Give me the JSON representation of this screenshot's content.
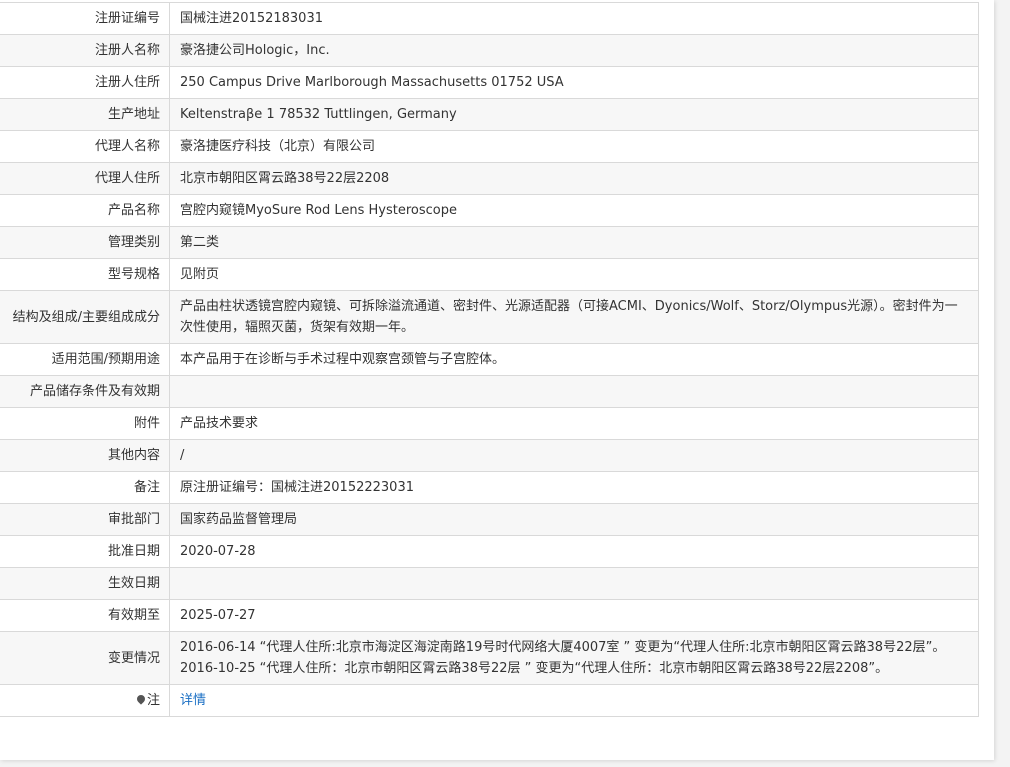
{
  "rows": [
    {
      "label": "注册证编号",
      "value": "国械注进20152183031"
    },
    {
      "label": "注册人名称",
      "value": "豪洛捷公司Hologic，Inc."
    },
    {
      "label": "注册人住所",
      "value": "250 Campus Drive Marlborough Massachusetts 01752 USA"
    },
    {
      "label": "生产地址",
      "value": "Keltenstraβe 1 78532 Tuttlingen, Germany"
    },
    {
      "label": "代理人名称",
      "value": "豪洛捷医疗科技（北京）有限公司"
    },
    {
      "label": "代理人住所",
      "value": "北京市朝阳区霄云路38号22层2208"
    },
    {
      "label": "产品名称",
      "value": "宫腔内窥镜MyoSure Rod Lens Hysteroscope"
    },
    {
      "label": "管理类别",
      "value": "第二类"
    },
    {
      "label": "型号规格",
      "value": "见附页"
    },
    {
      "label": "结构及组成/主要组成成分",
      "value": "产品由柱状透镜宫腔内窥镜、可拆除溢流通道、密封件、光源适配器（可接ACMI、Dyonics/Wolf、Storz/Olympus光源）。密封件为一次性使用，辐照灭菌，货架有效期一年。"
    },
    {
      "label": "适用范围/预期用途",
      "value": "本产品用于在诊断与手术过程中观察宫颈管与子宫腔体。"
    },
    {
      "label": "产品储存条件及有效期",
      "value": ""
    },
    {
      "label": "附件",
      "value": "产品技术要求"
    },
    {
      "label": "其他内容",
      "value": "/"
    },
    {
      "label": "备注",
      "value": "原注册证编号：国械注进20152223031"
    },
    {
      "label": "审批部门",
      "value": "国家药品监督管理局"
    },
    {
      "label": "批准日期",
      "value": "2020-07-28"
    },
    {
      "label": "生效日期",
      "value": ""
    },
    {
      "label": "有效期至",
      "value": "2025-07-27"
    }
  ],
  "changes": {
    "label": "变更情况",
    "entries": [
      "2016-06-14 “代理人住所:北京市海淀区海淀南路19号时代网络大厦4007室 ” 变更为“代理人住所:北京市朝阳区霄云路38号22层”。",
      "2016-10-25 “代理人住所：北京市朝阳区霄云路38号22层 ” 变更为“代理人住所：北京市朝阳区霄云路38号22层2208”。"
    ]
  },
  "note": {
    "icon": "location-pin-icon",
    "label": "注",
    "link_text": "详情"
  },
  "colors": {
    "border": "#d9d9d9",
    "alt_row": "#f7f7f7",
    "link": "#1a6fc4",
    "text": "#333333"
  }
}
